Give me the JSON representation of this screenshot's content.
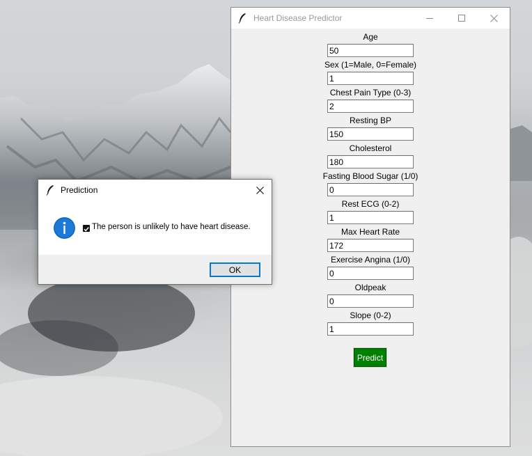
{
  "main_window": {
    "title": "Heart Disease Predictor",
    "title_icon": "feather-icon",
    "controls": {
      "minimize": "minimize-icon",
      "maximize": "maximize-icon",
      "close": "close-icon"
    },
    "fields": [
      {
        "label": "Age",
        "value": "50"
      },
      {
        "label": "Sex (1=Male, 0=Female)",
        "value": "1"
      },
      {
        "label": "Chest Pain Type (0-3)",
        "value": "2"
      },
      {
        "label": "Resting BP",
        "value": "150"
      },
      {
        "label": "Cholesterol",
        "value": "180"
      },
      {
        "label": "Fasting Blood Sugar (1/0)",
        "value": "0"
      },
      {
        "label": "Rest ECG (0-2)",
        "value": "1"
      },
      {
        "label": "Max Heart Rate",
        "value": "172"
      },
      {
        "label": "Exercise Angina (1/0)",
        "value": "0"
      },
      {
        "label": "Oldpeak",
        "value": "0"
      },
      {
        "label": "Slope (0-2)",
        "value": "1"
      }
    ],
    "predict_label": "Predict",
    "predict_color": "#008000"
  },
  "dialog": {
    "title": "Prediction",
    "title_icon": "feather-icon",
    "icon": "info-icon",
    "message": "The person is unlikely to have heart disease.",
    "message_prefix_icon": "checkbox-icon",
    "ok_label": "OK",
    "accent_color": "#0078d7"
  }
}
